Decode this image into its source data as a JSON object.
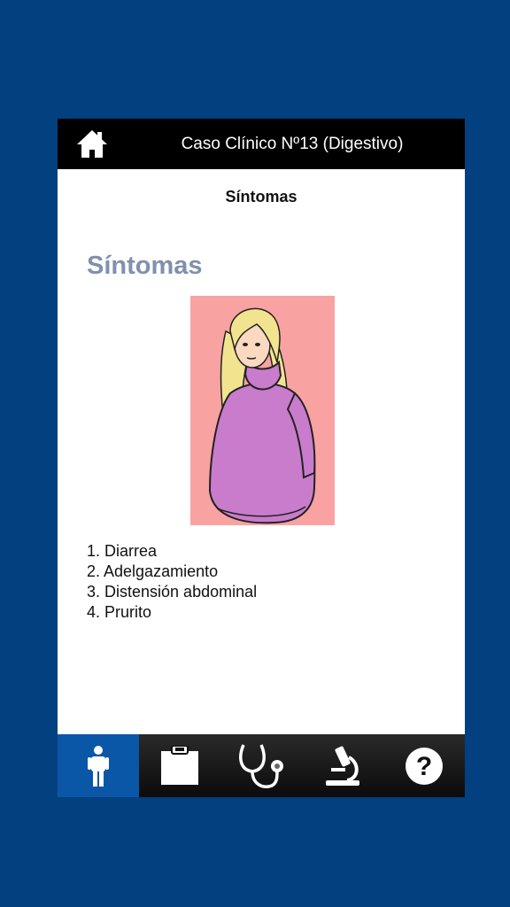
{
  "header": {
    "title": "Caso Clínico Nº13 (Digestivo)",
    "home_icon": "home-icon"
  },
  "section_header": "Síntomas",
  "content": {
    "heading": "Síntomas",
    "heading_color": "#8090ad",
    "image_background": "#f8a2a2",
    "symptoms": [
      "1. Diarrea",
      "2. Adelgazamiento",
      "3. Distensión abdominal",
      "4. Prurito"
    ]
  },
  "tabs": [
    {
      "icon": "person-icon",
      "active": true
    },
    {
      "icon": "clipboard-icon",
      "active": false
    },
    {
      "icon": "stethoscope-icon",
      "active": false
    },
    {
      "icon": "microscope-icon",
      "active": false
    },
    {
      "icon": "help-icon",
      "active": false
    }
  ],
  "colors": {
    "background": "#02407f",
    "topbar": "#000000",
    "active_tab": "#0a57a8"
  }
}
